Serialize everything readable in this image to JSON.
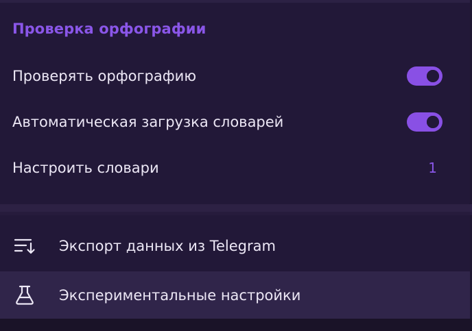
{
  "spellcheck": {
    "title": "Проверка орфографии",
    "rows": [
      {
        "label": "Проверять орфографию",
        "enabled": true
      },
      {
        "label": "Автоматическая загрузка словарей",
        "enabled": true
      }
    ],
    "dictionaries": {
      "label": "Настроить словари",
      "count": "1"
    }
  },
  "menu": {
    "export": {
      "label": "Экспорт данных из Telegram",
      "icon": "export-list-icon"
    },
    "experimental": {
      "label": "Экспериментальные настройки",
      "icon": "flask-icon"
    }
  },
  "colors": {
    "accent": "#8a56e8",
    "background": "#221838",
    "text": "#ece7f5"
  }
}
